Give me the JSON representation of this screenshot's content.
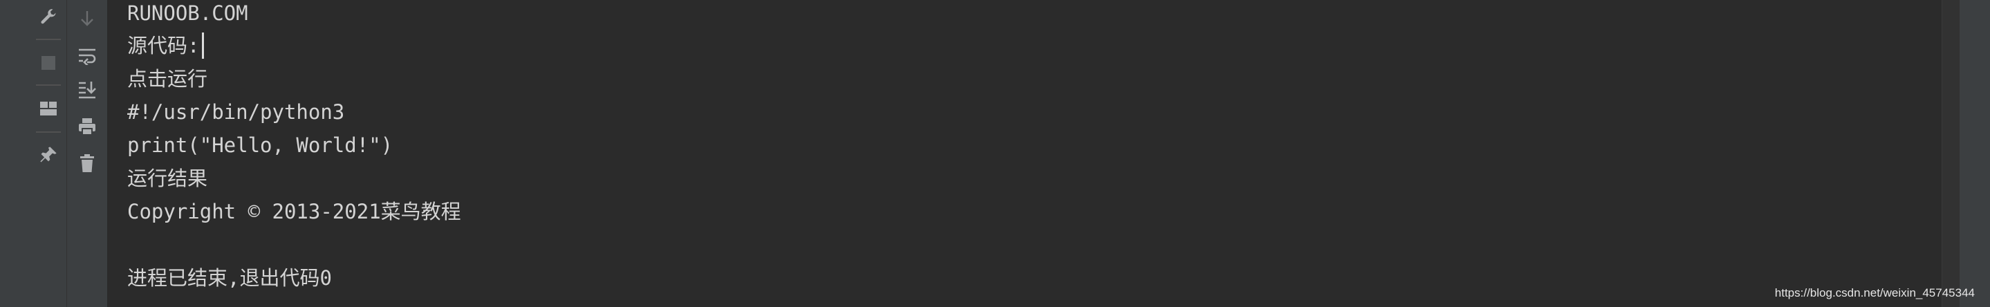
{
  "toolbar_left": {
    "buttons": [
      {
        "name": "settings-wrench-icon"
      },
      {
        "name": "stop-icon"
      },
      {
        "name": "layout-icon"
      },
      {
        "name": "pin-icon"
      }
    ]
  },
  "toolbar_right": {
    "buttons": [
      {
        "name": "down-arrow-icon"
      },
      {
        "name": "soft-wrap-icon"
      },
      {
        "name": "scroll-to-end-icon"
      },
      {
        "name": "print-icon"
      },
      {
        "name": "trash-icon"
      }
    ]
  },
  "console": {
    "lines": [
      "RUNOOB.COM",
      "源代码:",
      "点击运行",
      "#!/usr/bin/python3",
      "print(\"Hello, World!\")",
      "运行结果",
      "Copyright © 2013-2021菜鸟教程",
      "",
      "进程已结束,退出代码0"
    ]
  },
  "watermark": "https://blog.csdn.net/weixin_45745344",
  "colors": {
    "background": "#2b2b2b",
    "panel": "#3c3f41",
    "text": "#d4d4d4",
    "icon": "#afb1b3"
  }
}
